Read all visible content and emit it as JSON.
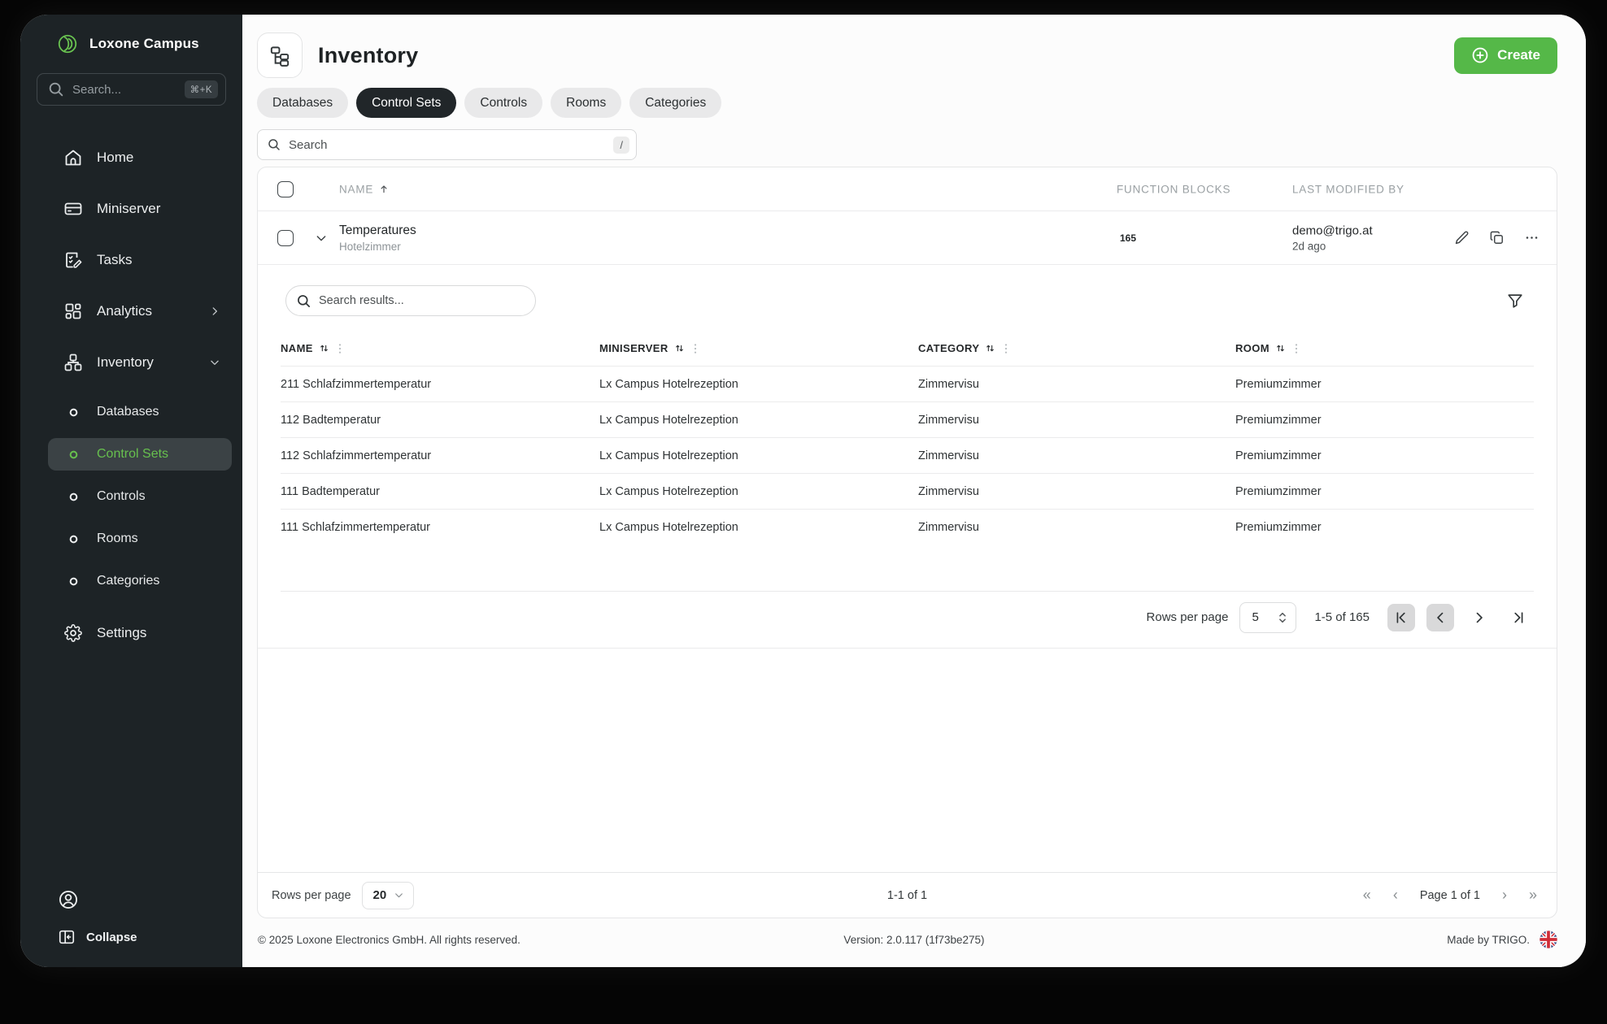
{
  "colors": {
    "accent_green": "#69C350",
    "create_green": "#55B848",
    "sidebar_bg": "#1D2326",
    "active_tab_bg": "#212629"
  },
  "sidebar": {
    "brand": "Loxone Campus",
    "search_placeholder": "Search...",
    "search_shortcut": "⌘+K",
    "items": [
      {
        "label": "Home"
      },
      {
        "label": "Miniserver"
      },
      {
        "label": "Tasks"
      },
      {
        "label": "Analytics"
      },
      {
        "label": "Inventory"
      }
    ],
    "subitems": [
      {
        "label": "Databases"
      },
      {
        "label": "Control Sets"
      },
      {
        "label": "Controls"
      },
      {
        "label": "Rooms"
      },
      {
        "label": "Categories"
      }
    ],
    "settings_label": "Settings",
    "collapse_label": "Collapse"
  },
  "header": {
    "title": "Inventory",
    "create_label": "Create"
  },
  "tabs": [
    {
      "label": "Databases"
    },
    {
      "label": "Control Sets"
    },
    {
      "label": "Controls"
    },
    {
      "label": "Rooms"
    },
    {
      "label": "Categories"
    }
  ],
  "toolbar": {
    "search_placeholder": "Search",
    "search_shortcut": "/"
  },
  "table": {
    "columns": {
      "name": "NAME",
      "function_blocks": "FUNCTION BLOCKS",
      "last_modified_by": "LAST MODIFIED BY"
    },
    "row": {
      "name": "Temperatures",
      "subtitle": "Hotelzimmer",
      "function_blocks": "165",
      "modified_by": "demo@trigo.at",
      "modified_ago": "2d ago"
    }
  },
  "details": {
    "search_placeholder": "Search results...",
    "columns": [
      "NAME",
      "MINISERVER",
      "CATEGORY",
      "ROOM"
    ],
    "rows": [
      [
        "211 Schlafzimmertemperatur",
        "Lx Campus Hotelrezeption",
        "Zimmervisu",
        "Premiumzimmer"
      ],
      [
        "112 Badtemperatur",
        "Lx Campus Hotelrezeption",
        "Zimmervisu",
        "Premiumzimmer"
      ],
      [
        "112 Schlafzimmertemperatur",
        "Lx Campus Hotelrezeption",
        "Zimmervisu",
        "Premiumzimmer"
      ],
      [
        "111 Badtemperatur",
        "Lx Campus Hotelrezeption",
        "Zimmervisu",
        "Premiumzimmer"
      ],
      [
        "111 Schlafzimmertemperatur",
        "Lx Campus Hotelrezeption",
        "Zimmervisu",
        "Premiumzimmer"
      ]
    ],
    "pagination": {
      "rows_per_page_label": "Rows per page",
      "rows_per_page": "5",
      "range": "1-5 of 165"
    }
  },
  "card_footer": {
    "rows_per_page_label": "Rows per page",
    "rows_per_page": "20",
    "range": "1-1 of 1",
    "page": "Page 1 of 1"
  },
  "app_footer": {
    "copyright": "© 2025 Loxone Electronics GmbH. All rights reserved.",
    "version": "Version: 2.0.117 (1f73be275)",
    "made_by": "Made by TRIGO."
  }
}
